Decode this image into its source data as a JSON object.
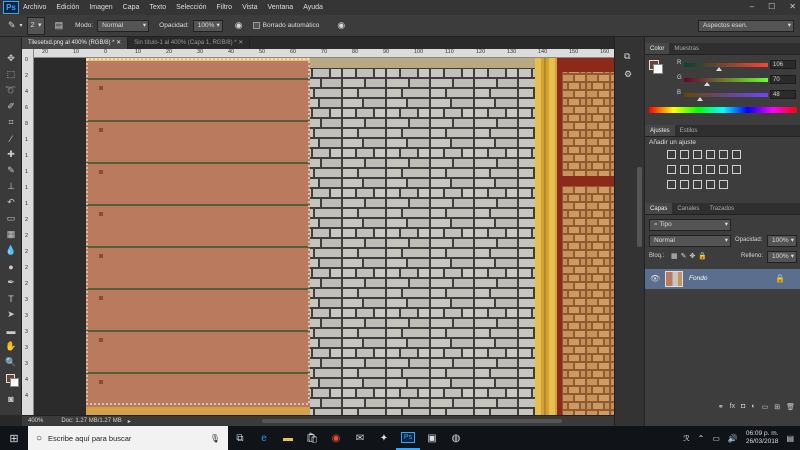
{
  "app": {
    "logo": "Ps"
  },
  "menu": [
    "Archivo",
    "Edición",
    "Imagen",
    "Capa",
    "Texto",
    "Selección",
    "Filtro",
    "Vista",
    "Ventana",
    "Ayuda"
  ],
  "options": {
    "brush_size": "2",
    "mode_label": "Modo:",
    "mode_value": "Normal",
    "opacity_label": "Opacidad:",
    "opacity_value": "100%",
    "auto_erase_label": "Borrado automático",
    "workspace": "Aspectos esen."
  },
  "tabs": [
    {
      "label": "Tilesetxd.png al 400% (RGB/8) *",
      "active": true
    },
    {
      "label": "Sin título-1 al 400% (Capa 1, RGB/8) *",
      "active": false
    }
  ],
  "ruler_top": [
    "20",
    "10",
    "0",
    "10",
    "20",
    "30",
    "40",
    "50",
    "60",
    "70",
    "80",
    "90",
    "100",
    "110",
    "120",
    "130",
    "140",
    "150",
    "160"
  ],
  "ruler_left": [
    "0",
    "2",
    "4",
    "6",
    "8",
    "1",
    "1",
    "1",
    "1",
    "1",
    "2",
    "2",
    "2",
    "2",
    "2",
    "3",
    "3",
    "3",
    "3",
    "3",
    "4",
    "4"
  ],
  "status": {
    "zoom": "400%",
    "doc": "Doc: 1.27 MB/1.27 MB"
  },
  "color_panel": {
    "tabs": [
      "Color",
      "Muestras"
    ],
    "r_label": "R",
    "r_value": "106",
    "r_fraction": 0.416,
    "g_label": "G",
    "g_value": "70",
    "g_fraction": 0.275,
    "b_label": "B",
    "b_value": "48",
    "b_fraction": 0.188,
    "foreground": "#6a4630"
  },
  "adjust_panel": {
    "tabs": [
      "Ajustes",
      "Estilos"
    ],
    "title": "Añadir un ajuste"
  },
  "layers_panel": {
    "tabs": [
      "Capas",
      "Canales",
      "Trazados"
    ],
    "kind_placeholder": "Tipo",
    "blend": "Normal",
    "opacity_label": "Opacidad:",
    "opacity_value": "100%",
    "lock_label": "Bloq.:",
    "fill_label": "Relleno:",
    "fill_value": "100%",
    "layer_name": "Fondo"
  },
  "taskbar": {
    "search_placeholder": "Escribe aquí para buscar",
    "time": "06:09 p. m.",
    "date": "26/03/2018"
  },
  "colors": {
    "wood": "#b97a5e",
    "plank_line": "#55603a",
    "stone": "#c8c6c0",
    "brick": "#c9945a",
    "accent": "#31a8ff"
  }
}
